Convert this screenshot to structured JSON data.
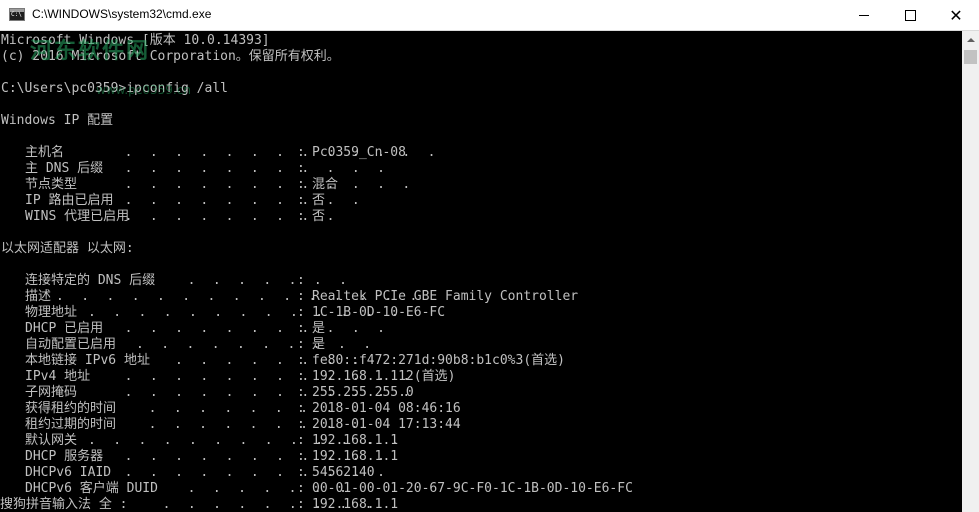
{
  "window": {
    "title": "C:\\WINDOWS\\system32\\cmd.exe",
    "minimize_glyph": "—",
    "maximize_glyph": "□",
    "close_glyph": "✕"
  },
  "watermark": {
    "text": "河东软件网",
    "sub": "www.pc0359.cn"
  },
  "console": {
    "header_line1": "Microsoft Windows [版本 10.0.14393]",
    "header_line2": "(c) 2016 Microsoft Corporation。保留所有权利。",
    "prompt": "C:\\Users\\pc0359>ipconfig /all",
    "section_ip": "Windows IP 配置",
    "ip_config": [
      {
        "key": "主机名",
        "dots": " . . . . . . . . . . . . .",
        "value": "Pc0359_Cn-08"
      },
      {
        "key": "主 DNS 后缀",
        "dots": " . . . . . . . . . . .",
        "value": ""
      },
      {
        "key": "节点类型",
        "dots": " . . . . . . . . . . . .",
        "value": "混合"
      },
      {
        "key": "IP 路由已启用",
        "dots": " . . . . . . . . . .",
        "value": "否"
      },
      {
        "key": "WINS 代理已启用",
        "dots": " . . . . . . . . .",
        "value": "否"
      }
    ],
    "section_adapter": "以太网适配器 以太网:",
    "adapter": [
      {
        "key": "连接特定的 DNS 后缀",
        "dots": " . . . . . . .",
        "value": ""
      },
      {
        "key": "描述",
        "dots": ". . . . . . . . . . . . . . .",
        "value": "Realtek PCIe GBE Family Controller"
      },
      {
        "key": "物理地址",
        "dots": ". . . . . . . . . . . . .",
        "value": "1C-1B-0D-10-E6-FC"
      },
      {
        "key": "DHCP 已启用",
        "dots": " . . . . . . . . . . .",
        "value": "是"
      },
      {
        "key": "自动配置已启用",
        "dots": ". . . . . . . . . .",
        "value": "是"
      },
      {
        "key": "本地链接 IPv6 地址",
        "dots": ". . . . . . . .",
        "value": "fe80::f472:271d:90b8:b1c0%3(首选)"
      },
      {
        "key": "IPv4 地址",
        "dots": " . . . . . . . . . . . .",
        "value": "192.168.1.112(首选)"
      },
      {
        "key": "子网掩码",
        "dots": " . . . . . . . . . . . .",
        "value": "255.255.255.0"
      },
      {
        "key": "获得租约的时间",
        "dots": " . . . . . . . . .",
        "value": "2018-01-04 08:46:16"
      },
      {
        "key": "租约过期的时间",
        "dots": " . . . . . . . . .",
        "value": "2018-01-04 17:13:44"
      },
      {
        "key": "默认网关",
        "dots": ". . . . . . . . . . . . .",
        "value": "192.168.1.1"
      },
      {
        "key": "DHCP 服务器",
        "dots": " . . . . . . . . . . .",
        "value": "192.168.1.1"
      },
      {
        "key": "DHCPv6 IAID",
        "dots": " . . . . . . . . . . .",
        "value": "54562140"
      },
      {
        "key": "DHCPv6 客户端 DUID",
        "dots": " . . . . . . .",
        "value": "00-01-00-01-20-67-9C-F0-1C-1B-0D-10-E6-FC"
      }
    ],
    "ime_prefix": "搜狗拼音输入法 全 :",
    "ime_dots": " . . . . . . . . .",
    "ime_value": "192.168.1.1"
  }
}
